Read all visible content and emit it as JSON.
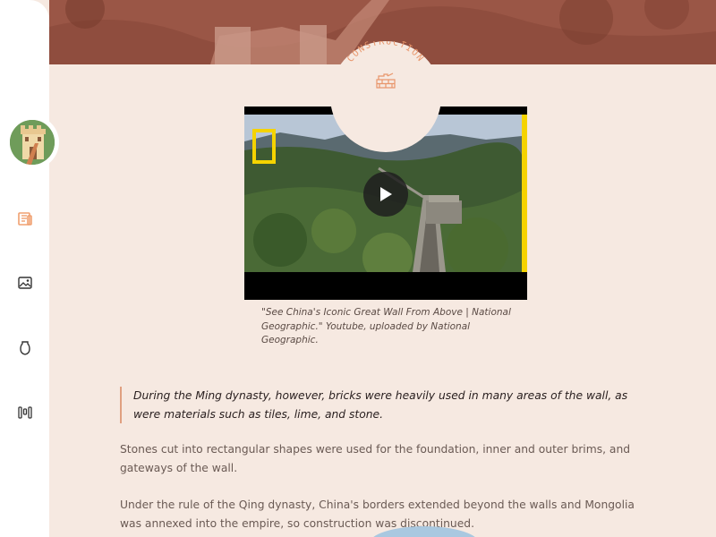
{
  "section": {
    "badge_label": "CONSTRUCTION",
    "badge_icon": "brick-wall-icon"
  },
  "sidebar": {
    "avatar_icon": "great-wall-avatar-icon",
    "items": [
      {
        "icon": "newspaper-icon",
        "color": "#f0a070"
      },
      {
        "icon": "image-gallery-icon",
        "color": "#333333"
      },
      {
        "icon": "vase-icon",
        "color": "#333333"
      },
      {
        "icon": "timeline-icon",
        "color": "#333333"
      }
    ]
  },
  "video": {
    "caption": "\"See China's Iconic Great Wall From Above | National Geographic.\" Youtube, uploaded by National Geographic."
  },
  "content": {
    "quote": "During the Ming dynasty, however, bricks were heavily used in many areas of the wall, as were materials such as tiles, lime, and stone.",
    "paragraph_1": "Stones cut into rectangular shapes were used for the foundation, inner and outer brims, and gateways of the wall.",
    "paragraph_2": "Under the rule of the Qing dynasty, China's borders extended beyond the walls and Mongolia was annexed into the empire, so construction was discontinued."
  },
  "colors": {
    "background": "#f6e9e1",
    "accent": "#f0a070",
    "ng_yellow": "#f5d300"
  }
}
